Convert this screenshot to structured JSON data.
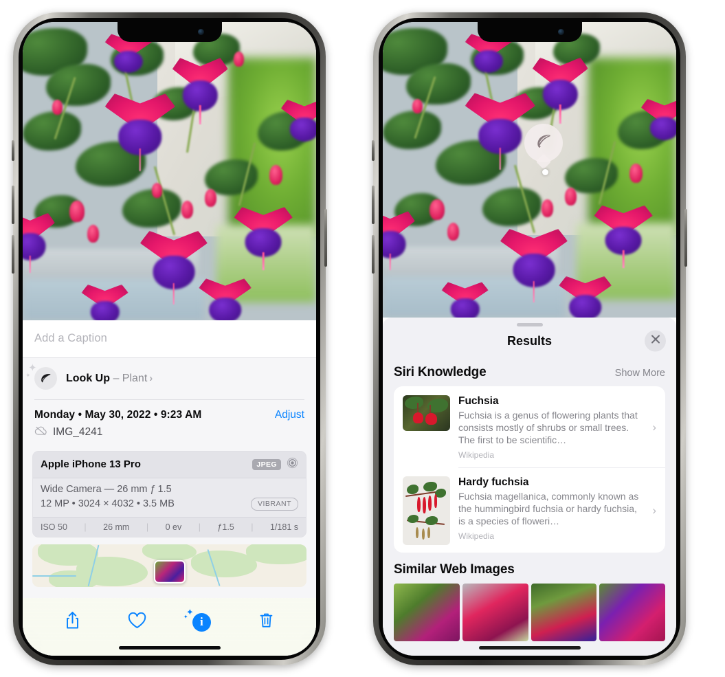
{
  "left_phone": {
    "caption": {
      "placeholder": "Add a Caption",
      "value": ""
    },
    "lookup": {
      "label": "Look Up",
      "dash": " – ",
      "subject": "Plant",
      "chevron": "›",
      "icon": "leaf-icon"
    },
    "date": {
      "text": "Monday • May 30, 2022 • 9:23 AM",
      "adjust_label": "Adjust"
    },
    "file": {
      "name": "IMG_4241",
      "icon": "icloud-slash-icon"
    },
    "exif": {
      "model": "Apple iPhone 13 Pro",
      "format_badge": "JPEG",
      "aperture_icon": "camera-aperture-icon",
      "lens_line": "Wide Camera — 26 mm ƒ 1.5",
      "size_line": "12 MP • 3024 × 4032 • 3.5 MB",
      "style_badge": "VIBRANT",
      "stats": [
        "ISO 50",
        "26 mm",
        "0 ev",
        "ƒ1.5",
        "1/181 s"
      ],
      "separator": "|"
    },
    "toolbar": [
      {
        "name": "share-button",
        "icon": "share-icon"
      },
      {
        "name": "favorite-button",
        "icon": "heart-icon"
      },
      {
        "name": "info-button",
        "icon": "info-sparkle-icon",
        "active": true
      },
      {
        "name": "delete-button",
        "icon": "trash-icon"
      }
    ]
  },
  "right_phone": {
    "visual_lookup_badge": {
      "icon": "leaf-icon"
    },
    "sheet": {
      "title": "Results",
      "close_icon": "close-icon",
      "grabber": "sheet-grabber"
    },
    "siri_knowledge": {
      "title": "Siri Knowledge",
      "show_more": "Show More",
      "items": [
        {
          "title": "Fuchsia",
          "description": "Fuchsia is a genus of flowering plants that consists mostly of shrubs or small trees. The first to be scientific…",
          "source": "Wikipedia",
          "chevron": "›"
        },
        {
          "title": "Hardy fuchsia",
          "description": "Fuchsia magellanica, commonly known as the hummingbird fuchsia or hardy fuchsia, is a species of floweri…",
          "source": "Wikipedia",
          "chevron": "›"
        }
      ]
    },
    "similar_web_images": {
      "title": "Similar Web Images",
      "count": 4
    }
  },
  "colors": {
    "accent_blue": "#0a84ff",
    "sheet_bg": "#f1f1f5",
    "card_bg": "#ffffff",
    "secondary_text": "#86868c"
  }
}
